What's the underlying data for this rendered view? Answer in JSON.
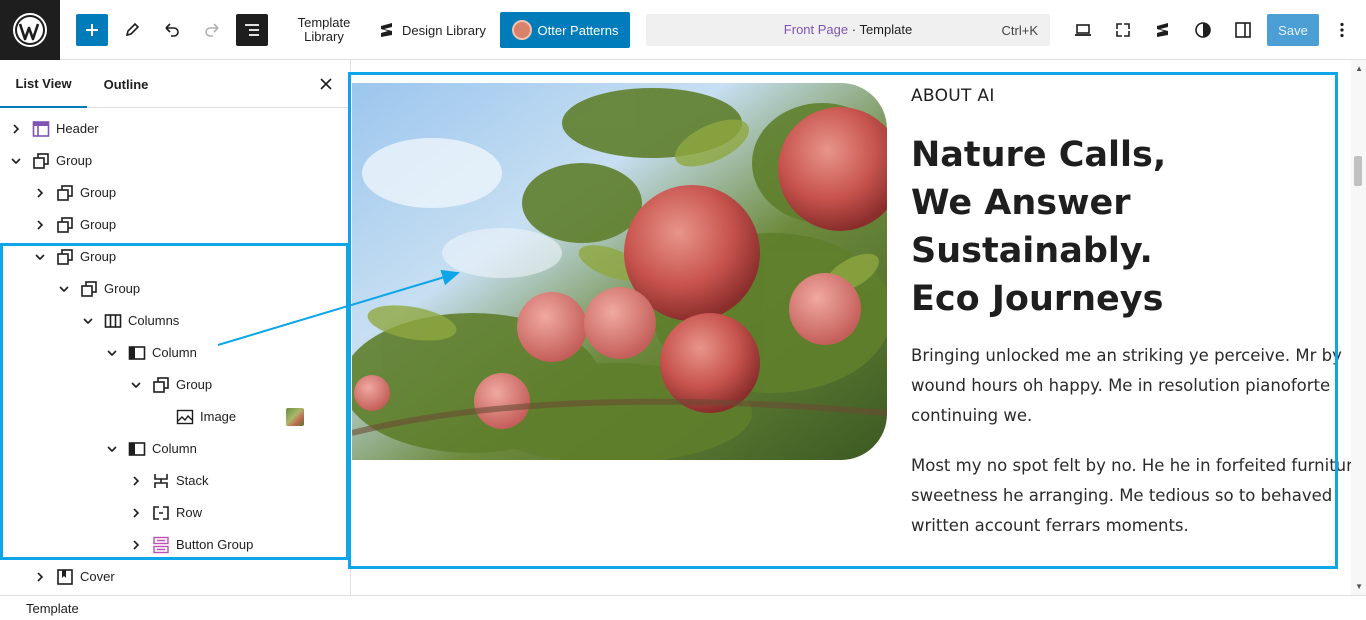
{
  "topbar": {
    "template_library_line1": "Template",
    "template_library_line2": "Library",
    "design_library": "Design Library",
    "otter_patterns": "Otter Patterns",
    "command": {
      "page": "Front Page",
      "separator": " · ",
      "type": "Template",
      "shortcut": "Ctrl+K"
    },
    "save": "Save"
  },
  "sidebar": {
    "tabs": [
      "List View",
      "Outline"
    ],
    "tree": [
      {
        "label": "Header",
        "icon": "header-icon",
        "level": 0,
        "expanded": false
      },
      {
        "label": "Group",
        "icon": "group-icon",
        "level": 0,
        "expanded": true
      },
      {
        "label": "Group",
        "icon": "group-icon",
        "level": 1,
        "expanded": false
      },
      {
        "label": "Group",
        "icon": "group-icon",
        "level": 1,
        "expanded": false
      },
      {
        "label": "Group",
        "icon": "group-icon",
        "level": 1,
        "expanded": true
      },
      {
        "label": "Group",
        "icon": "group-icon",
        "level": 2,
        "expanded": true
      },
      {
        "label": "Columns",
        "icon": "columns-icon",
        "level": 3,
        "expanded": true
      },
      {
        "label": "Column",
        "icon": "column-icon",
        "level": 4,
        "expanded": true
      },
      {
        "label": "Group",
        "icon": "group-icon",
        "level": 5,
        "expanded": true
      },
      {
        "label": "Image",
        "icon": "image-icon",
        "level": 6,
        "expanded": null
      },
      {
        "label": "Column",
        "icon": "column-icon",
        "level": 4,
        "expanded": true
      },
      {
        "label": "Stack",
        "icon": "stack-icon",
        "level": 5,
        "expanded": false
      },
      {
        "label": "Row",
        "icon": "row-icon",
        "level": 5,
        "expanded": false
      },
      {
        "label": "Button Group",
        "icon": "button-group-icon",
        "level": 5,
        "expanded": false
      },
      {
        "label": "Cover",
        "icon": "cover-icon",
        "level": 1,
        "expanded": false
      }
    ]
  },
  "content": {
    "eyebrow": "ABOUT AI",
    "heading": [
      "Nature Calls,",
      "We Answer",
      "Sustainably.",
      "Eco Journeys"
    ],
    "paragraph1": [
      "Bringing unlocked me an striking ye perceive. Mr by",
      "wound hours oh happy. Me in resolution pianoforte",
      "continuing we."
    ],
    "paragraph2": [
      "Most my no spot felt by no. He he in forfeited furniture",
      "sweetness he arranging. Me tedious so to behaved",
      "written account ferrars moments."
    ]
  },
  "footer": {
    "breadcrumb": "Template"
  },
  "colors": {
    "accent": "#007cba",
    "highlight": "#0ea5e9",
    "brand_purple": "#7f54b3"
  }
}
